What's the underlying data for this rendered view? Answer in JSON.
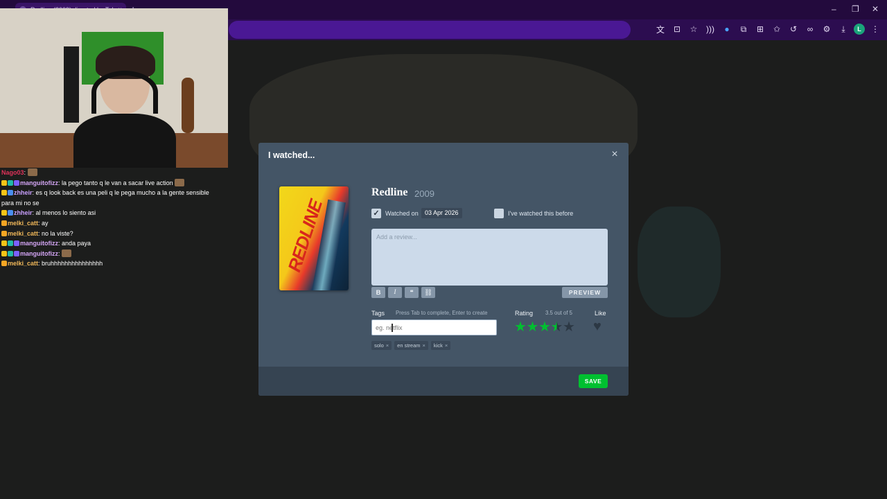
{
  "browser": {
    "tab_title": "Redline (2009) directed by Takes",
    "tab_close": "×",
    "new_tab": "+",
    "window_controls": [
      "–",
      "❐",
      "✕"
    ],
    "profile_initial": "L"
  },
  "chat": {
    "messages": [
      {
        "user": "Nago03",
        "user_color": "#e0325a",
        "text": "",
        "emote": true,
        "badges": []
      },
      {
        "user": "manguitofizz",
        "user_color": "#d4a6f5",
        "text": "la pego tanto q le van a sacar live action",
        "emote": true,
        "badges": [
          "#f5c518",
          "#21b9a8",
          "#7b61ff"
        ]
      },
      {
        "user": "zhheir",
        "user_color": "#c9a0ff",
        "text": "es q look back es una peli q le pega mucho a la gente sensible para mi no se",
        "emote": false,
        "badges": [
          "#f5c518",
          "#4a8ef0"
        ]
      },
      {
        "user": "zhheir",
        "user_color": "#c9a0ff",
        "text": "al menos lo siento asi",
        "emote": false,
        "badges": [
          "#f5c518",
          "#4a8ef0"
        ]
      },
      {
        "user": "melki_catt",
        "user_color": "#f0b85a",
        "text": "ay",
        "emote": false,
        "badges": [
          "#f5a623"
        ]
      },
      {
        "user": "melki_catt",
        "user_color": "#f0b85a",
        "text": "no la viste?",
        "emote": false,
        "badges": [
          "#f5a623"
        ]
      },
      {
        "user": "manguitofizz",
        "user_color": "#d4a6f5",
        "text": "anda paya",
        "emote": false,
        "badges": [
          "#f5c518",
          "#21b9a8",
          "#7b61ff"
        ]
      },
      {
        "user": "manguitofizz",
        "user_color": "#d4a6f5",
        "text": "",
        "emote": true,
        "badges": [
          "#f5c518",
          "#21b9a8",
          "#7b61ff"
        ]
      },
      {
        "user": "melki_catt",
        "user_color": "#f0b85a",
        "text": "bruhhhhhhhhhhhhhhh",
        "emote": false,
        "badges": [
          "#f5a623"
        ]
      }
    ]
  },
  "modal": {
    "title": "I watched...",
    "close_icon": "×",
    "film": {
      "title": "Redline",
      "year": "2009",
      "poster_text": "REDLINE"
    },
    "watched_on_label": "Watched on",
    "watched_on_checked": true,
    "watched_date": "03 Apr 2026",
    "rewatch_label": "I've watched this before",
    "rewatch_checked": false,
    "review_placeholder": "Add a review...",
    "format_buttons": [
      {
        "name": "bold-button",
        "glyph": "B"
      },
      {
        "name": "italic-button",
        "glyph": "I"
      },
      {
        "name": "quote-button",
        "glyph": "❝"
      },
      {
        "name": "link-button",
        "glyph": "⛓"
      }
    ],
    "preview_label": "PREVIEW",
    "tags_label": "Tags",
    "tags_hint": "Press Tab to complete, Enter to create",
    "tags_placeholder": "eg. netflix",
    "tags": [
      "solo",
      "en stream",
      "kick"
    ],
    "tag_remove": "×",
    "rating_label": "Rating",
    "rating_value_text": "3.5 out of 5",
    "rating": 3.5,
    "like_label": "Like",
    "liked": false,
    "save_label": "SAVE",
    "accent_color": "#00c030"
  }
}
